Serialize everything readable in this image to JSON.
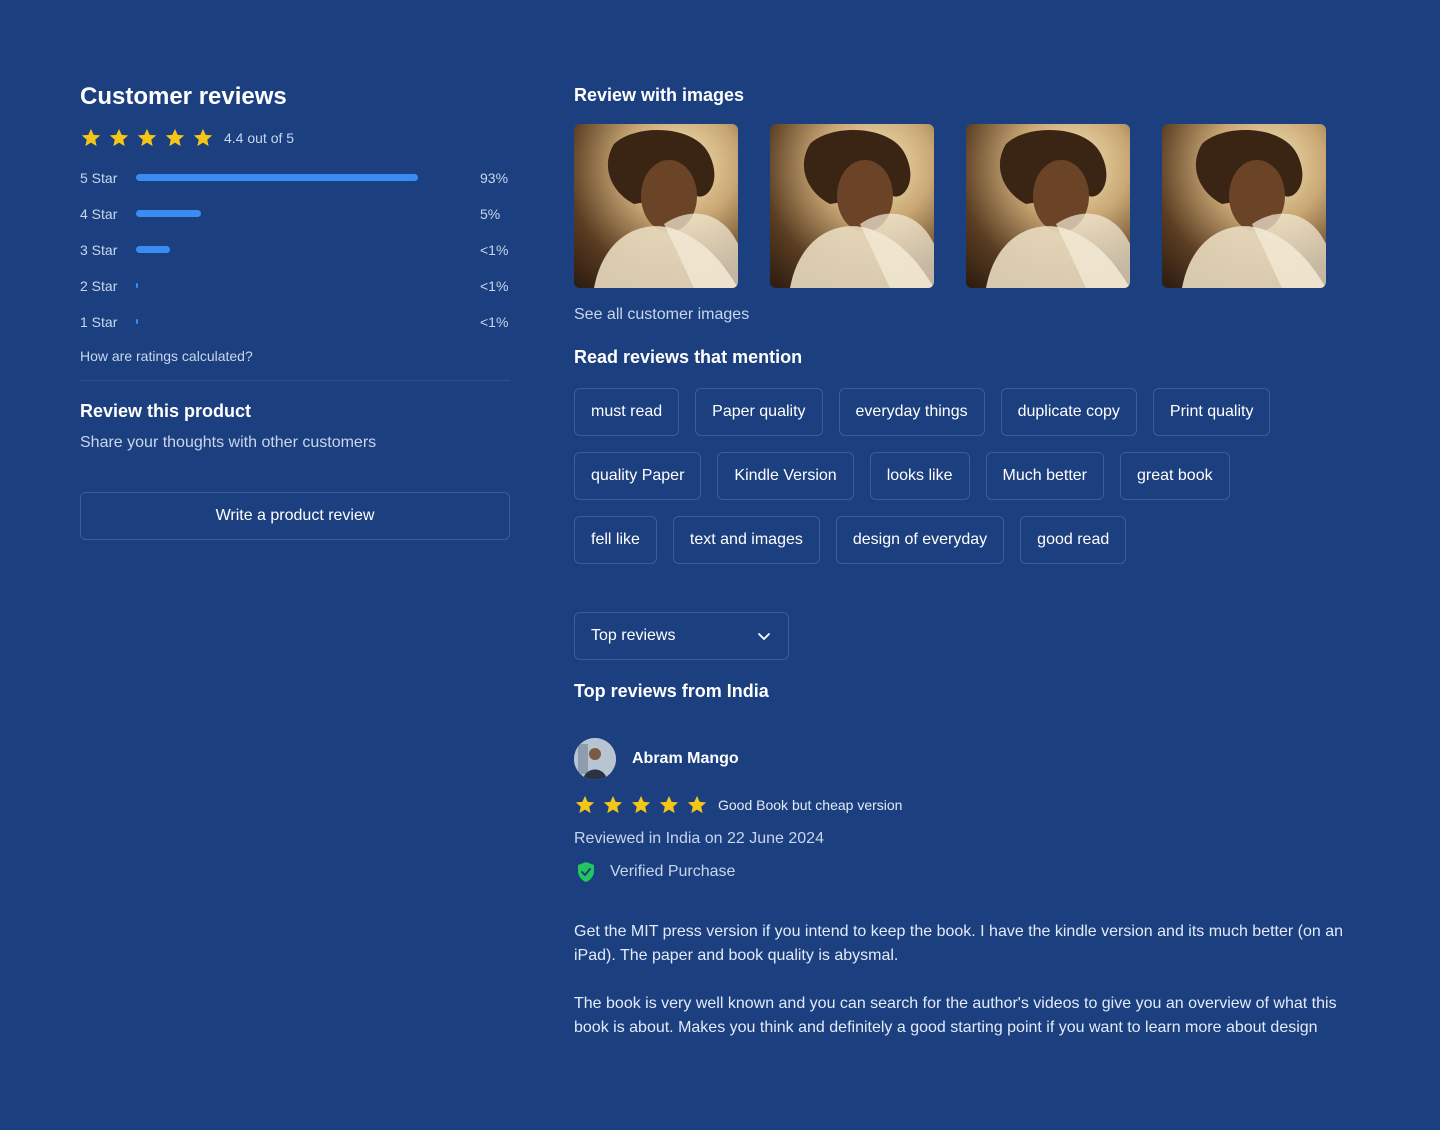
{
  "summary": {
    "title": "Customer reviews",
    "rating": 4.4,
    "rating_text": "4.4 out of 5",
    "star_color": "#f5c518",
    "histogram": [
      {
        "label": "5 Star",
        "pct_text": "93%",
        "fill_fraction": 0.82
      },
      {
        "label": "4 Star",
        "pct_text": "5%",
        "fill_fraction": 0.19
      },
      {
        "label": "3 Star",
        "pct_text": "<1%",
        "fill_fraction": 0.1
      },
      {
        "label": "2 Star",
        "pct_text": "<1%",
        "fill_fraction": 0.005
      },
      {
        "label": "1 Star",
        "pct_text": "<1%",
        "fill_fraction": 0.005
      }
    ],
    "how_link": "How are ratings calculated?"
  },
  "review_product": {
    "title": "Review this product",
    "subtitle": "Share your thoughts with other customers",
    "button_label": "Write a product review"
  },
  "images_section": {
    "title": "Review with images",
    "see_all": "See all customer images"
  },
  "mentions": {
    "title": "Read reviews that mention",
    "rows": [
      [
        "must read",
        "Paper quality",
        "everyday things",
        "duplicate copy",
        "Print quality"
      ],
      [
        "quality Paper",
        "Kindle Version",
        "looks like",
        "Much better",
        "great book"
      ],
      [
        "fell like",
        "text and images",
        "design of everyday",
        "good read"
      ]
    ]
  },
  "sort": {
    "selected": "Top reviews"
  },
  "top_reviews_title": "Top reviews from India",
  "review": {
    "name": "Abram Mango",
    "stars": 5,
    "headline": "Good Book but cheap version",
    "reviewed_in": "Reviewed in India on 22 June 2024",
    "verified": "Verified Purchase",
    "verified_color": "#22c55e",
    "paragraphs": [
      "Get the MIT press version if you intend to keep the book. I have the kindle version and its much better (on an iPad). The paper and book quality is abysmal.",
      "The book is very well known and you can search for the author's videos to give you an overview of what this book is about. Makes you think and definitely a good starting point if you want to learn more about design"
    ]
  }
}
